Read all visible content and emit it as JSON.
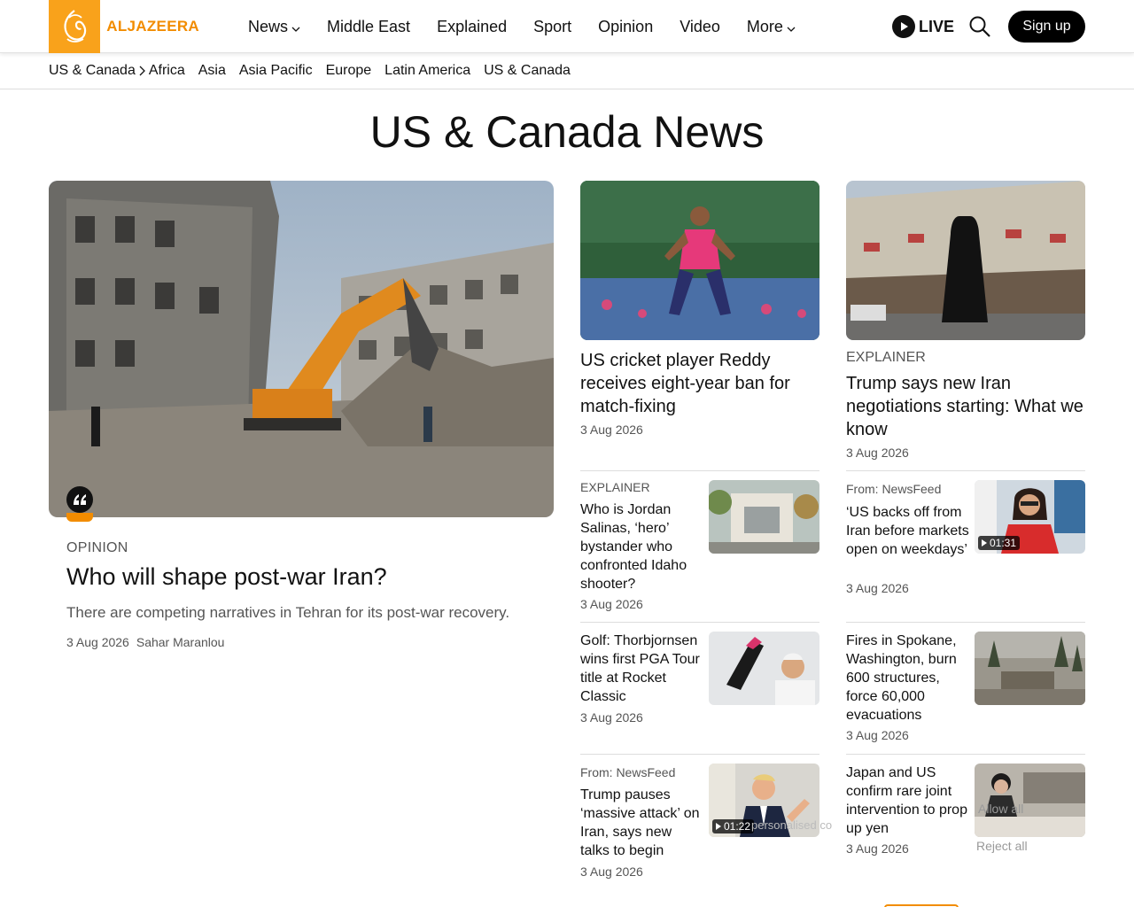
{
  "header": {
    "logo_text": "ALJAZEERA",
    "nav": [
      "News",
      "Middle East",
      "Explained",
      "Sport",
      "Opinion",
      "Video",
      "More"
    ],
    "live_label": "LIVE",
    "signup_label": "Sign up"
  },
  "subnav": {
    "breadcrumb": "US & Canada",
    "links": [
      "Africa",
      "Asia",
      "Asia Pacific",
      "Europe",
      "Latin America",
      "US & Canada"
    ]
  },
  "page_title": "US & Canada News",
  "feature": {
    "kicker": "OPINION",
    "title": "Who will shape post-war Iran?",
    "description": "There are competing narratives in Tehran for its post-war recovery.",
    "date": "3 Aug 2026",
    "author": "Sahar Maranlou"
  },
  "medium_cards": [
    {
      "kicker": "",
      "title": "US cricket player Reddy receives eight-year ban for match-fixing",
      "date": "3 Aug 2026"
    },
    {
      "kicker": "EXPLAINER",
      "title": "Trump says new Iran negotiations starting: What we know",
      "date": "3 Aug 2026"
    }
  ],
  "small_cards_left": [
    {
      "kicker": "EXPLAINER",
      "title": "Who is Jordan Salinas, ‘hero’ bystander who confronted Idaho shooter?",
      "date": "3 Aug 2026",
      "video": ""
    },
    {
      "kicker": "",
      "title": "Golf: Thorbjornsen wins first PGA Tour title at Rocket Classic",
      "date": "3 Aug 2026",
      "video": ""
    },
    {
      "kicker": "From: NewsFeed",
      "title": "Trump pauses ‘massive attack’ on Iran, says new talks to begin",
      "date": "3 Aug 2026",
      "video": "01:22"
    }
  ],
  "small_cards_right": [
    {
      "kicker": "From: NewsFeed",
      "title": "‘US backs off from Iran before markets open on weekdays’",
      "date": "3 Aug 2026",
      "video": "01:31"
    },
    {
      "kicker": "",
      "title": "Fires in Spokane, Washington, burn 600 structures, force 60,000 evacuations",
      "date": "3 Aug 2026",
      "video": ""
    },
    {
      "kicker": "",
      "title": "Japan and US confirm rare joint intervention to prop up yen",
      "date": "3 Aug 2026",
      "video": ""
    }
  ],
  "cookie_overlay": {
    "partial_text": "personalised co",
    "allow_all": "Allow all",
    "reject_all": "Reject all"
  }
}
